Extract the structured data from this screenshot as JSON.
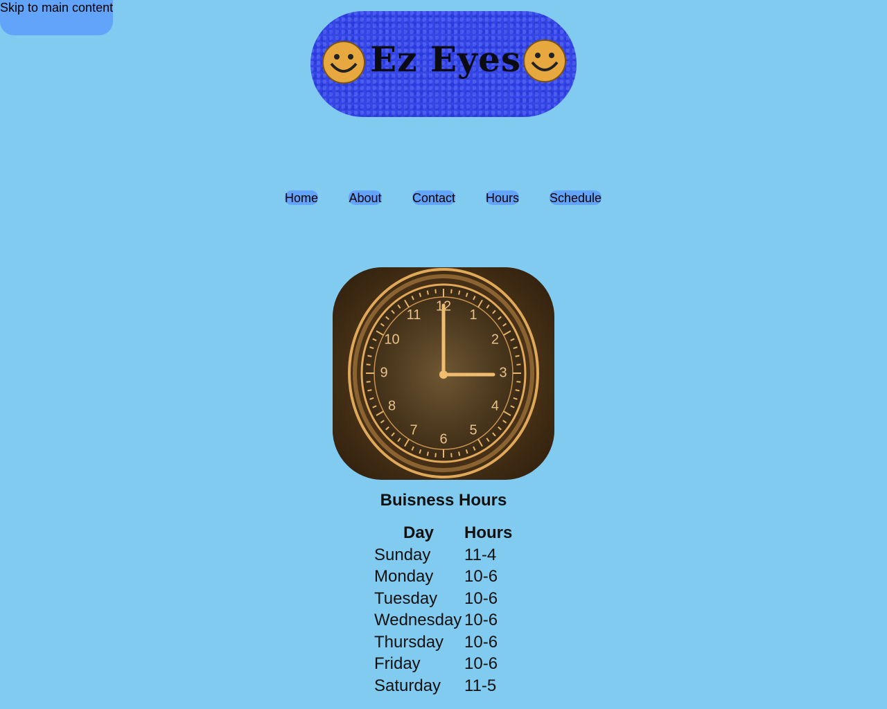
{
  "skip_link": {
    "label": "Skip to main content"
  },
  "logo": {
    "text": "Ez Eyes"
  },
  "nav": {
    "items": [
      {
        "label": "Home"
      },
      {
        "label": "About"
      },
      {
        "label": "Contact"
      },
      {
        "label": "Hours"
      },
      {
        "label": "Schedule"
      }
    ]
  },
  "clock": {
    "numerals": [
      "12",
      "1",
      "2",
      "3",
      "4",
      "5",
      "6",
      "7",
      "8",
      "9",
      "10",
      "11"
    ],
    "time_shown": "3:00"
  },
  "hours": {
    "title": "Buisness Hours",
    "headers": {
      "day": "Day",
      "hours": "Hours"
    },
    "rows": [
      {
        "day": "Sunday",
        "hours": "11-4"
      },
      {
        "day": "Monday",
        "hours": "10-6"
      },
      {
        "day": "Tuesday",
        "hours": "10-6"
      },
      {
        "day": "Wednesday",
        "hours": "10-6"
      },
      {
        "day": "Thursday",
        "hours": "10-6"
      },
      {
        "day": "Friday",
        "hours": "10-6"
      },
      {
        "day": "Saturday",
        "hours": "11-5"
      }
    ]
  },
  "colors": {
    "page_background": "#81caf0",
    "button_background": "#63a4fb",
    "logo_background": "#3545e6",
    "clock_brass": "#e0a95a",
    "clock_dark": "#4b3217"
  }
}
